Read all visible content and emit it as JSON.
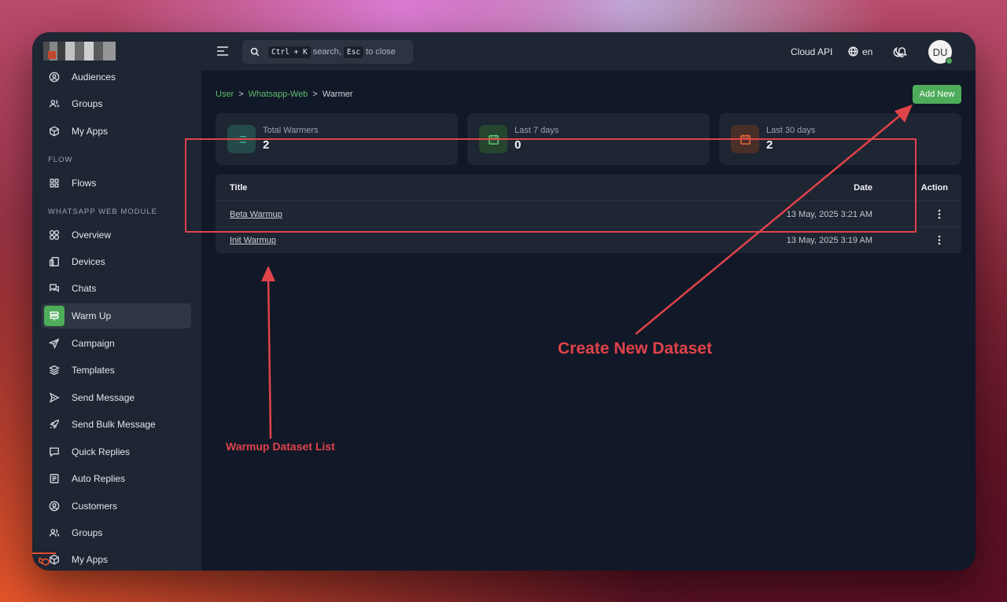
{
  "sidebar": {
    "items": [
      {
        "id": "audiences",
        "label": "Audiences",
        "icon": "user-circle-icon"
      },
      {
        "id": "groups",
        "label": "Groups",
        "icon": "users-icon"
      },
      {
        "id": "my-apps",
        "label": "My Apps",
        "icon": "cube-icon"
      },
      {
        "id": "flows",
        "label": "Flows",
        "icon": "grid-icon"
      },
      {
        "id": "overview",
        "label": "Overview",
        "icon": "circles-icon"
      },
      {
        "id": "devices",
        "label": "Devices",
        "icon": "devices-icon"
      },
      {
        "id": "chats",
        "label": "Chats",
        "icon": "chat-icon"
      },
      {
        "id": "warm-up",
        "label": "Warm Up",
        "icon": "warmup-icon",
        "active": true
      },
      {
        "id": "campaign",
        "label": "Campaign",
        "icon": "send-icon"
      },
      {
        "id": "templates",
        "label": "Templates",
        "icon": "layers-icon"
      },
      {
        "id": "send-message",
        "label": "Send Message",
        "icon": "play-send-icon"
      },
      {
        "id": "send-bulk-message",
        "label": "Send Bulk Message",
        "icon": "rocket-icon"
      },
      {
        "id": "quick-replies",
        "label": "Quick Replies",
        "icon": "message-square-icon"
      },
      {
        "id": "auto-replies",
        "label": "Auto Replies",
        "icon": "document-icon"
      },
      {
        "id": "customers",
        "label": "Customers",
        "icon": "user-circle-icon"
      },
      {
        "id": "groups-2",
        "label": "Groups",
        "icon": "users-icon"
      },
      {
        "id": "my-apps-2",
        "label": "My Apps",
        "icon": "cube-icon"
      }
    ],
    "sections": {
      "flow": "FLOW",
      "whatsapp_web": "WHATSAPP WEB MODULE"
    }
  },
  "topbar": {
    "search_prefix_key": "Ctrl + K",
    "search_middle": "search,",
    "search_esc_key": "Esc",
    "search_suffix": "to close",
    "cloud_api": "Cloud API",
    "language": "en",
    "avatar_initials": "DU"
  },
  "breadcrumb": {
    "items": [
      "User",
      "Whatsapp-Web",
      "Warmer"
    ],
    "separator": ">"
  },
  "add_new_label": "Add New",
  "stats": [
    {
      "label": "Total Warmers",
      "value": "2",
      "color": "#3fa98f",
      "bg": "#244a4a",
      "icon": "list-icon"
    },
    {
      "label": "Last 7 days",
      "value": "0",
      "color": "#5fbf6e",
      "bg": "#25452f",
      "icon": "calendar-icon"
    },
    {
      "label": "Last 30 days",
      "value": "2",
      "color": "#e0683a",
      "bg": "#4a2f28",
      "icon": "calendar-icon"
    }
  ],
  "table": {
    "headers": {
      "title": "Title",
      "date": "Date",
      "action": "Action"
    },
    "rows": [
      {
        "title": "Beta Warmup",
        "date": "13 May, 2025 3:21 AM"
      },
      {
        "title": "Init Warmup",
        "date": "13 May, 2025 3:19 AM"
      }
    ]
  },
  "annotations": {
    "create_new": "Create New Dataset",
    "dataset_list": "Warmup Dataset List",
    "color": "#e0434a"
  },
  "colors": {
    "accent": "#4ead5b",
    "bg_main": "#111827",
    "bg_panel": "#1e2533"
  }
}
